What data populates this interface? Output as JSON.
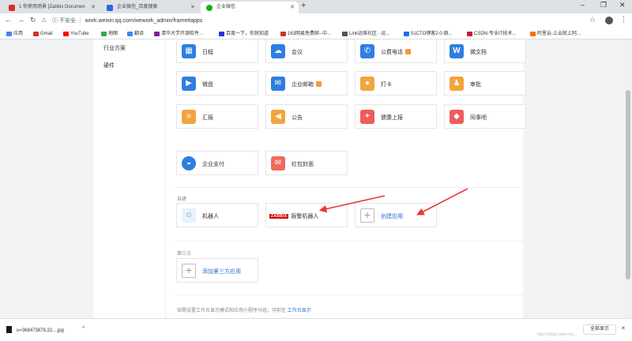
{
  "tabs": [
    {
      "label": "1 你使用场景 [Zabbix Documen",
      "color": "#d93025"
    },
    {
      "label": "企业微信_百度搜索",
      "color": "#2b6bd7"
    },
    {
      "label": "企业微信",
      "color": "#1aad19"
    }
  ],
  "address": {
    "insecure": "不安全",
    "url": "work.weixin.qq.com/wework_admin/frame#apps"
  },
  "bookmarks": [
    {
      "label": "应用",
      "color": "#4285f4"
    },
    {
      "label": "Gmail",
      "color": "#d93025"
    },
    {
      "label": "YouTube",
      "color": "#ff0000"
    },
    {
      "label": "地图",
      "color": "#34a853"
    },
    {
      "label": "翻译",
      "color": "#4285f4"
    },
    {
      "label": "清华大学开源软件...",
      "color": "#7b1fa2"
    },
    {
      "label": "百度一下，你就知道",
      "color": "#2932e1"
    },
    {
      "label": "163网易免费邮--中...",
      "color": "#d93025"
    },
    {
      "label": "Link运维社区 - 运...",
      "color": "#555555"
    },
    {
      "label": "51CTO博客2.0-原...",
      "color": "#1a73e8"
    },
    {
      "label": "CSDN-专业IT技术...",
      "color": "#c32136"
    },
    {
      "label": "阿里云-上云就上阿...",
      "color": "#ff6a00"
    }
  ],
  "sidebar": {
    "items": [
      "行业方案",
      "硬件"
    ]
  },
  "apps_row1": [
    {
      "label": "日程",
      "color": "#2d7fe0",
      "icon": "calendar-icon",
      "glyph": "▦",
      "badge": false
    },
    {
      "label": "会议",
      "color": "#2d7fe0",
      "icon": "cloud-meeting-icon",
      "glyph": "☁",
      "badge": false
    },
    {
      "label": "公费电话",
      "color": "#2d7fe0",
      "icon": "phone-icon",
      "glyph": "✆",
      "badge": true
    },
    {
      "label": "微文档",
      "color": "#2d7fe0",
      "icon": "document-icon",
      "glyph": "W",
      "badge": false
    }
  ],
  "apps_row2": [
    {
      "label": "微盘",
      "color": "#2d7fe0",
      "icon": "drive-icon",
      "glyph": "▶",
      "badge": false
    },
    {
      "label": "企业邮箱",
      "color": "#2d7fe0",
      "icon": "mail-icon",
      "glyph": "✉",
      "badge": true
    },
    {
      "label": "打卡",
      "color": "#f3a43b",
      "icon": "location-icon",
      "glyph": "●",
      "badge": false
    },
    {
      "label": "审批",
      "color": "#f3a43b",
      "icon": "stamp-icon",
      "glyph": "♟",
      "badge": false
    }
  ],
  "apps_row3": [
    {
      "label": "汇报",
      "color": "#f3a43b",
      "icon": "report-icon",
      "glyph": "≡",
      "badge": false
    },
    {
      "label": "公告",
      "color": "#f3a43b",
      "icon": "megaphone-icon",
      "glyph": "◀",
      "badge": false
    },
    {
      "label": "健康上报",
      "color": "#ef5b5b",
      "icon": "health-icon",
      "glyph": "+",
      "badge": false
    },
    {
      "label": "同事吧",
      "color": "#ef5b5b",
      "icon": "colleague-icon",
      "glyph": "◆",
      "badge": false
    }
  ],
  "apps_row4": [
    {
      "label": "企业支付",
      "color": "#2d7fe0",
      "icon": "payment-icon",
      "glyph": "◒",
      "badge": false
    },
    {
      "label": "红包封面",
      "color": "#ef6b5b",
      "icon": "red-envelope-icon",
      "glyph": "✉",
      "badge": false
    }
  ],
  "custom": {
    "title": "自建",
    "robot": "机器人",
    "zabbix_logo": "ZABBIX",
    "alert_robot": "报警机器人",
    "create": "创建应用"
  },
  "third_party": {
    "title": "第三方",
    "add": "添加第三方应用"
  },
  "note": {
    "text": "如需设置工作台显示模式和应用小程序分组，可前往",
    "link": "工作台显示"
  },
  "download": {
    "file": "u=368473878,22....jpg",
    "show_all": "全部显示"
  },
  "watermark": "https://blog.csdn.net/..."
}
